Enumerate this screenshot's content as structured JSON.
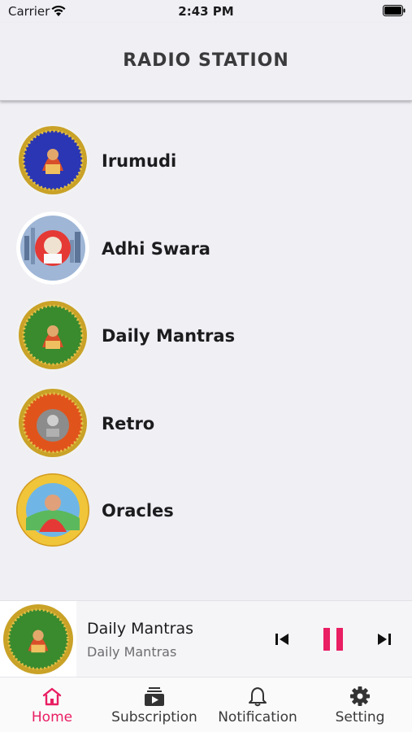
{
  "status_bar": {
    "carrier": "Carrier",
    "time": "2:43 PM"
  },
  "header": {
    "title": "RADIO STATION"
  },
  "stations": [
    {
      "name": "Irumudi",
      "logo_icon": "irumudi-logo-icon"
    },
    {
      "name": "Adhi Swara",
      "logo_icon": "adhi-swara-logo-icon"
    },
    {
      "name": "Daily Mantras",
      "logo_icon": "daily-mantras-logo-icon"
    },
    {
      "name": "Retro",
      "logo_icon": "retro-logo-icon"
    },
    {
      "name": "Oracles",
      "logo_icon": "oracles-logo-icon"
    }
  ],
  "player": {
    "title": "Daily Mantras",
    "subtitle": "Daily Mantras",
    "state": "playing"
  },
  "tabs": [
    {
      "label": "Home",
      "icon": "home-icon",
      "active": true
    },
    {
      "label": "Subscription",
      "icon": "subscription-icon",
      "active": false
    },
    {
      "label": "Notification",
      "icon": "bell-icon",
      "active": false
    },
    {
      "label": "Setting",
      "icon": "gear-icon",
      "active": false
    }
  ],
  "colors": {
    "accent": "#e91e63",
    "background": "#efeff4"
  }
}
